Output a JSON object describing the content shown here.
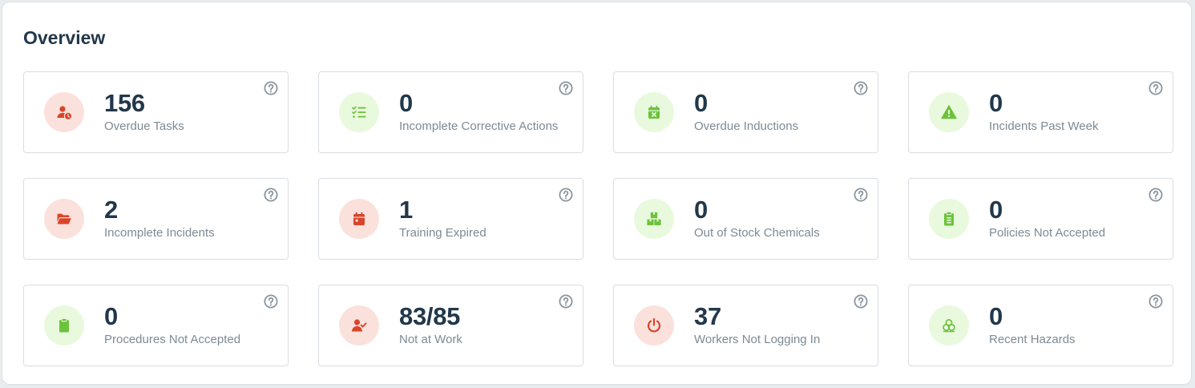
{
  "overview": {
    "title": "Overview",
    "colors": {
      "red_bg": "#fbe1dc",
      "red_fg": "#d9442a",
      "green_bg": "#e9f9dd",
      "green_fg": "#6cc23b",
      "help": "#8a959e"
    },
    "cards": [
      {
        "value": "156",
        "label": "Overdue Tasks",
        "icon": "user-clock-icon",
        "tone": "red"
      },
      {
        "value": "0",
        "label": "Incomplete Corrective Actions",
        "icon": "checklist-icon",
        "tone": "green"
      },
      {
        "value": "0",
        "label": "Overdue Inductions",
        "icon": "calendar-x-icon",
        "tone": "green"
      },
      {
        "value": "0",
        "label": "Incidents Past Week",
        "icon": "warning-icon",
        "tone": "green"
      },
      {
        "value": "2",
        "label": "Incomplete Incidents",
        "icon": "folder-open-icon",
        "tone": "red"
      },
      {
        "value": "1",
        "label": "Training Expired",
        "icon": "calendar-icon",
        "tone": "red"
      },
      {
        "value": "0",
        "label": "Out of Stock Chemicals",
        "icon": "boxes-icon",
        "tone": "green"
      },
      {
        "value": "0",
        "label": "Policies Not Accepted",
        "icon": "clipboard-list-icon",
        "tone": "green"
      },
      {
        "value": "0",
        "label": "Procedures Not Accepted",
        "icon": "clipboard-icon",
        "tone": "green"
      },
      {
        "value": "83/85",
        "label": "Not at Work",
        "icon": "user-check-icon",
        "tone": "red"
      },
      {
        "value": "37",
        "label": "Workers Not Logging In",
        "icon": "power-icon",
        "tone": "red"
      },
      {
        "value": "0",
        "label": "Recent Hazards",
        "icon": "biohazard-icon",
        "tone": "green"
      }
    ]
  }
}
